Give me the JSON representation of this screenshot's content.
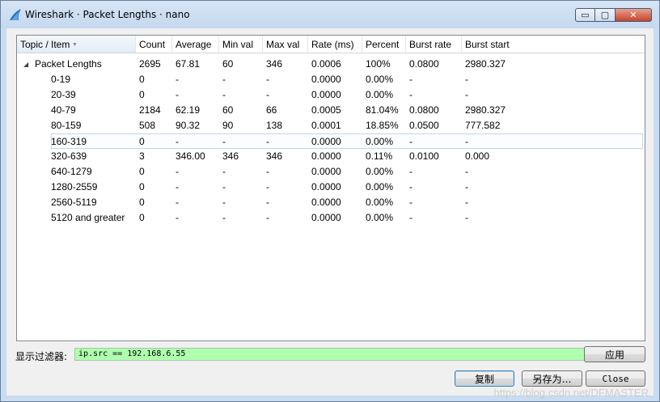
{
  "window": {
    "title": "Wireshark · Packet Lengths · nano"
  },
  "window_buttons": {
    "minimize": "▭",
    "maximize": "▢",
    "close": "✕"
  },
  "columns": [
    "Topic / Item",
    "Count",
    "Average",
    "Min val",
    "Max val",
    "Rate (ms)",
    "Percent",
    "Burst rate",
    "Burst start"
  ],
  "rows": [
    {
      "topic": "Packet Lengths",
      "count": "2695",
      "average": "67.81",
      "min": "60",
      "max": "346",
      "rate": "0.0006",
      "percent": "100%",
      "burst_rate": "0.0800",
      "burst_start": "2980.327"
    },
    {
      "topic": "0-19",
      "count": "0",
      "average": "-",
      "min": "-",
      "max": "-",
      "rate": "0.0000",
      "percent": "0.00%",
      "burst_rate": "-",
      "burst_start": "-"
    },
    {
      "topic": "20-39",
      "count": "0",
      "average": "-",
      "min": "-",
      "max": "-",
      "rate": "0.0000",
      "percent": "0.00%",
      "burst_rate": "-",
      "burst_start": "-"
    },
    {
      "topic": "40-79",
      "count": "2184",
      "average": "62.19",
      "min": "60",
      "max": "66",
      "rate": "0.0005",
      "percent": "81.04%",
      "burst_rate": "0.0800",
      "burst_start": "2980.327"
    },
    {
      "topic": "80-159",
      "count": "508",
      "average": "90.32",
      "min": "90",
      "max": "138",
      "rate": "0.0001",
      "percent": "18.85%",
      "burst_rate": "0.0500",
      "burst_start": "777.582"
    },
    {
      "topic": "160-319",
      "count": "0",
      "average": "-",
      "min": "-",
      "max": "-",
      "rate": "0.0000",
      "percent": "0.00%",
      "burst_rate": "-",
      "burst_start": "-"
    },
    {
      "topic": "320-639",
      "count": "3",
      "average": "346.00",
      "min": "346",
      "max": "346",
      "rate": "0.0000",
      "percent": "0.11%",
      "burst_rate": "0.0100",
      "burst_start": "0.000"
    },
    {
      "topic": "640-1279",
      "count": "0",
      "average": "-",
      "min": "-",
      "max": "-",
      "rate": "0.0000",
      "percent": "0.00%",
      "burst_rate": "-",
      "burst_start": "-"
    },
    {
      "topic": "1280-2559",
      "count": "0",
      "average": "-",
      "min": "-",
      "max": "-",
      "rate": "0.0000",
      "percent": "0.00%",
      "burst_rate": "-",
      "burst_start": "-"
    },
    {
      "topic": "2560-5119",
      "count": "0",
      "average": "-",
      "min": "-",
      "max": "-",
      "rate": "0.0000",
      "percent": "0.00%",
      "burst_rate": "-",
      "burst_start": "-"
    },
    {
      "topic": "5120 and greater",
      "count": "0",
      "average": "-",
      "min": "-",
      "max": "-",
      "rate": "0.0000",
      "percent": "0.00%",
      "burst_rate": "-",
      "burst_start": "-"
    }
  ],
  "filter": {
    "label": "显示过滤器:",
    "value": "ip.src == 192.168.6.55"
  },
  "buttons": {
    "apply": "应用",
    "copy": "复制",
    "save_as": "另存为…",
    "close": "Close"
  },
  "watermark": "https://blog.csdn.net/DFMASTER",
  "colors": {
    "filter_bg": "#afffaf",
    "titlebar": "#c9dcf1",
    "selection_border": "#c4d6ea"
  },
  "icons": {
    "app": "wireshark-fin-icon",
    "expand": "expanded-triangle-icon",
    "sort": "sort-indicator-icon"
  }
}
